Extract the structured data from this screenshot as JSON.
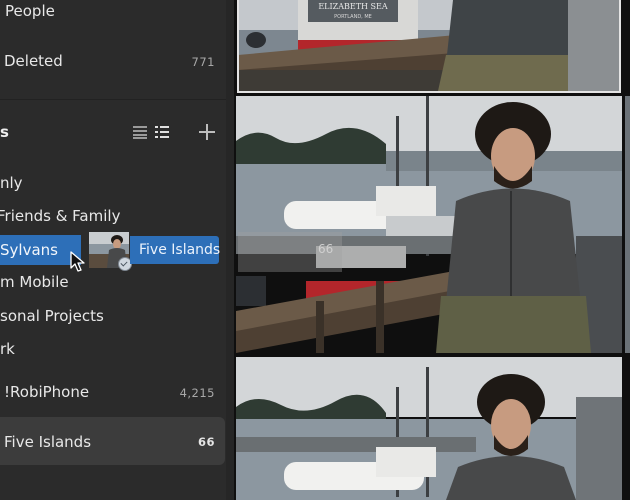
{
  "sidebar": {
    "items_top": [
      {
        "label": "People",
        "count": ""
      },
      {
        "label": "Deleted",
        "count": "771"
      }
    ],
    "section_title": "s",
    "albums": [
      {
        "label": "nly"
      },
      {
        "label": " Friends & Family"
      },
      {
        "label": "Sylvans"
      },
      {
        "label": "m Mobile"
      },
      {
        "label": "sonal Projects"
      },
      {
        "label": "rk"
      },
      {
        "label": "!RobiPhone",
        "count": "4,215"
      },
      {
        "label": "Five Islands",
        "count": "66"
      }
    ],
    "icons": [
      "list-view-icon",
      "grid-view-icon",
      "add-icon"
    ]
  },
  "drag": {
    "target_label": "Five Islands",
    "count_badge": "66",
    "icons": [
      "photo-thumbnail",
      "check-icon",
      "arrow-cursor-icon"
    ]
  },
  "photos": {
    "sign_line1": "ELIZABETH SEA",
    "sign_line2": "PORTLAND, ME"
  },
  "colors": {
    "sidebar_bg": "#2b2b2b",
    "accent_blue": "#2d6fb8",
    "selected_row": "#3c3c3c"
  }
}
